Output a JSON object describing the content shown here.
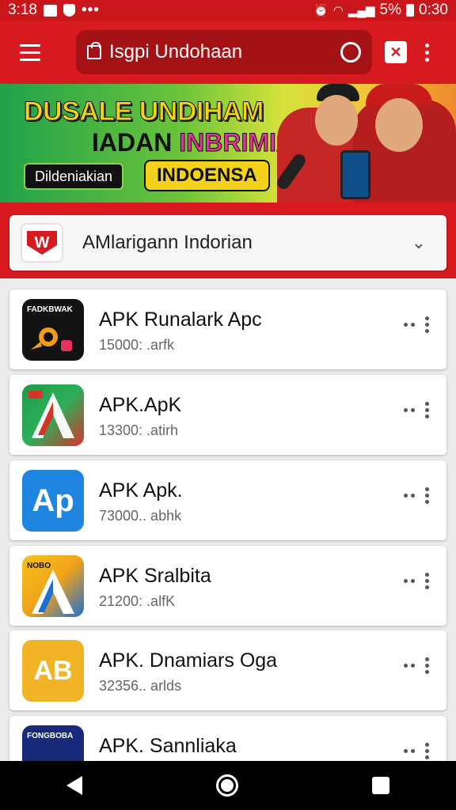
{
  "status_bar": {
    "time": "3:18",
    "battery_text": "5%",
    "clock": "0:30"
  },
  "app_bar": {
    "search_text": "Isgpi Undohaan"
  },
  "banner": {
    "line1": "DUSALE UNDIHAM",
    "line2_a": "IADAN ",
    "line2_b": "INBRIMIA!",
    "pill_left": "Dildeniakian",
    "pill_right": "INDOENSA"
  },
  "category": {
    "logo_letter": "W",
    "label": "AMlarigann Indorian"
  },
  "apps": [
    {
      "name": "APK Runalark Apc",
      "meta": "15000: .arfk",
      "icon_text": "FADKBWAK"
    },
    {
      "name": "APK.ApK",
      "meta": "13300: .atirh",
      "icon_text": ""
    },
    {
      "name": "APK Apk.",
      "meta": "73000.. abhk",
      "icon_text": "Ap"
    },
    {
      "name": "APK Sralbita",
      "meta": "21200: .alfK",
      "icon_text": "NOBO"
    },
    {
      "name": "APK. Dnamiars Oga",
      "meta": "32356.. arlds",
      "icon_text": "AB"
    },
    {
      "name": "APK. Sannliaka",
      "meta": "",
      "icon_text": "FONGBOBA"
    }
  ],
  "colors": {
    "primary": "#d81b20",
    "primary_dark": "#a51216"
  }
}
